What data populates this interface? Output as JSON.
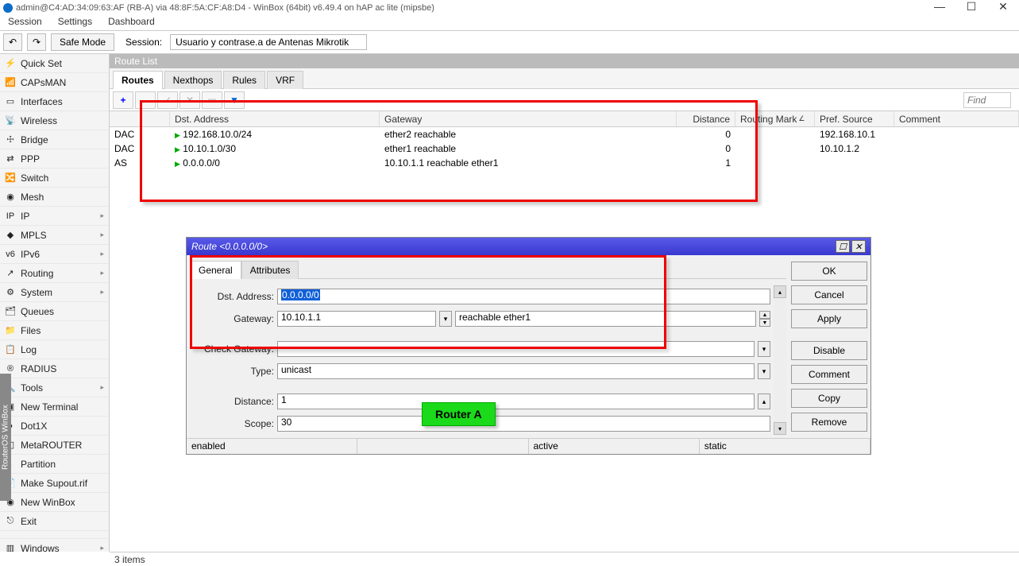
{
  "title": "admin@C4:AD:34:09:63:AF (RB-A) via 48:8F:5A:CF:A8:D4 - WinBox (64bit) v6.49.4 on hAP ac lite (mipsbe)",
  "menu": {
    "session": "Session",
    "settings": "Settings",
    "dashboard": "Dashboard"
  },
  "toolbar": {
    "safe_mode": "Safe Mode",
    "session_label": "Session:",
    "session_value": "Usuario y contrase.a de Antenas Mikrotik"
  },
  "sidebar": {
    "items": [
      {
        "label": "Quick Set",
        "icon": "⚡",
        "arrow": false
      },
      {
        "label": "CAPsMAN",
        "icon": "📶",
        "arrow": false
      },
      {
        "label": "Interfaces",
        "icon": "▭",
        "arrow": false
      },
      {
        "label": "Wireless",
        "icon": "📡",
        "arrow": false
      },
      {
        "label": "Bridge",
        "icon": "☩",
        "arrow": false
      },
      {
        "label": "PPP",
        "icon": "⇄",
        "arrow": false
      },
      {
        "label": "Switch",
        "icon": "🔀",
        "arrow": false
      },
      {
        "label": "Mesh",
        "icon": "◉",
        "arrow": false
      },
      {
        "label": "IP",
        "icon": "IP",
        "arrow": true
      },
      {
        "label": "MPLS",
        "icon": "◆",
        "arrow": true
      },
      {
        "label": "IPv6",
        "icon": "v6",
        "arrow": true
      },
      {
        "label": "Routing",
        "icon": "↗",
        "arrow": true
      },
      {
        "label": "System",
        "icon": "⚙",
        "arrow": true
      },
      {
        "label": "Queues",
        "icon": "🗂",
        "arrow": false
      },
      {
        "label": "Files",
        "icon": "📁",
        "arrow": false
      },
      {
        "label": "Log",
        "icon": "📋",
        "arrow": false
      },
      {
        "label": "RADIUS",
        "icon": "®",
        "arrow": false
      },
      {
        "label": "Tools",
        "icon": "🔧",
        "arrow": true
      },
      {
        "label": "New Terminal",
        "icon": "▣",
        "arrow": false
      },
      {
        "label": "Dot1X",
        "icon": "●",
        "arrow": false
      },
      {
        "label": "MetaROUTER",
        "icon": "◧",
        "arrow": false
      },
      {
        "label": "Partition",
        "icon": "◐",
        "arrow": false
      },
      {
        "label": "Make Supout.rif",
        "icon": "📄",
        "arrow": false
      },
      {
        "label": "New WinBox",
        "icon": "◉",
        "arrow": false
      },
      {
        "label": "Exit",
        "icon": "⎋",
        "arrow": false
      },
      {
        "label": "Windows",
        "icon": "▥",
        "arrow": true
      }
    ]
  },
  "panel": {
    "title": "Route List"
  },
  "tabs": {
    "routes": "Routes",
    "nexthops": "Nexthops",
    "rules": "Rules",
    "vrf": "VRF"
  },
  "list_toolbar": {
    "find": "Find"
  },
  "columns": {
    "dst": "Dst. Address",
    "gateway": "Gateway",
    "distance": "Distance",
    "routing_mark": "Routing Mark",
    "pref_source": "Pref. Source",
    "comment": "Comment"
  },
  "rows": [
    {
      "flags": "DAC",
      "dst": "192.168.10.0/24",
      "gw": "ether2 reachable",
      "dist": "0",
      "mark": "",
      "pref": "192.168.10.1",
      "comment": ""
    },
    {
      "flags": "DAC",
      "dst": "10.10.1.0/30",
      "gw": "ether1 reachable",
      "dist": "0",
      "mark": "",
      "pref": "10.10.1.2",
      "comment": ""
    },
    {
      "flags": "AS",
      "dst": "0.0.0.0/0",
      "gw": "10.10.1.1 reachable ether1",
      "dist": "1",
      "mark": "",
      "pref": "",
      "comment": ""
    }
  ],
  "dialog": {
    "title": "Route <0.0.0.0/0>",
    "tabs": {
      "general": "General",
      "attributes": "Attributes"
    },
    "fields": {
      "dst_label": "Dst. Address:",
      "dst_value": "0.0.0.0/0",
      "gw_label": "Gateway:",
      "gw_value": "10.10.1.1",
      "gw_status": "reachable ether1",
      "check_label": "Check Gateway:",
      "type_label": "Type:",
      "type_value": "unicast",
      "distance_label": "Distance:",
      "distance_value": "1",
      "scope_label": "Scope:",
      "scope_value": "30"
    },
    "buttons": {
      "ok": "OK",
      "cancel": "Cancel",
      "apply": "Apply",
      "disable": "Disable",
      "comment": "Comment",
      "copy": "Copy",
      "remove": "Remove"
    },
    "status": {
      "enabled": "enabled",
      "active": "active",
      "static": "static"
    }
  },
  "green_label": "Router A",
  "status_bar": "3 items",
  "ros_label": "RouterOS WinBox"
}
